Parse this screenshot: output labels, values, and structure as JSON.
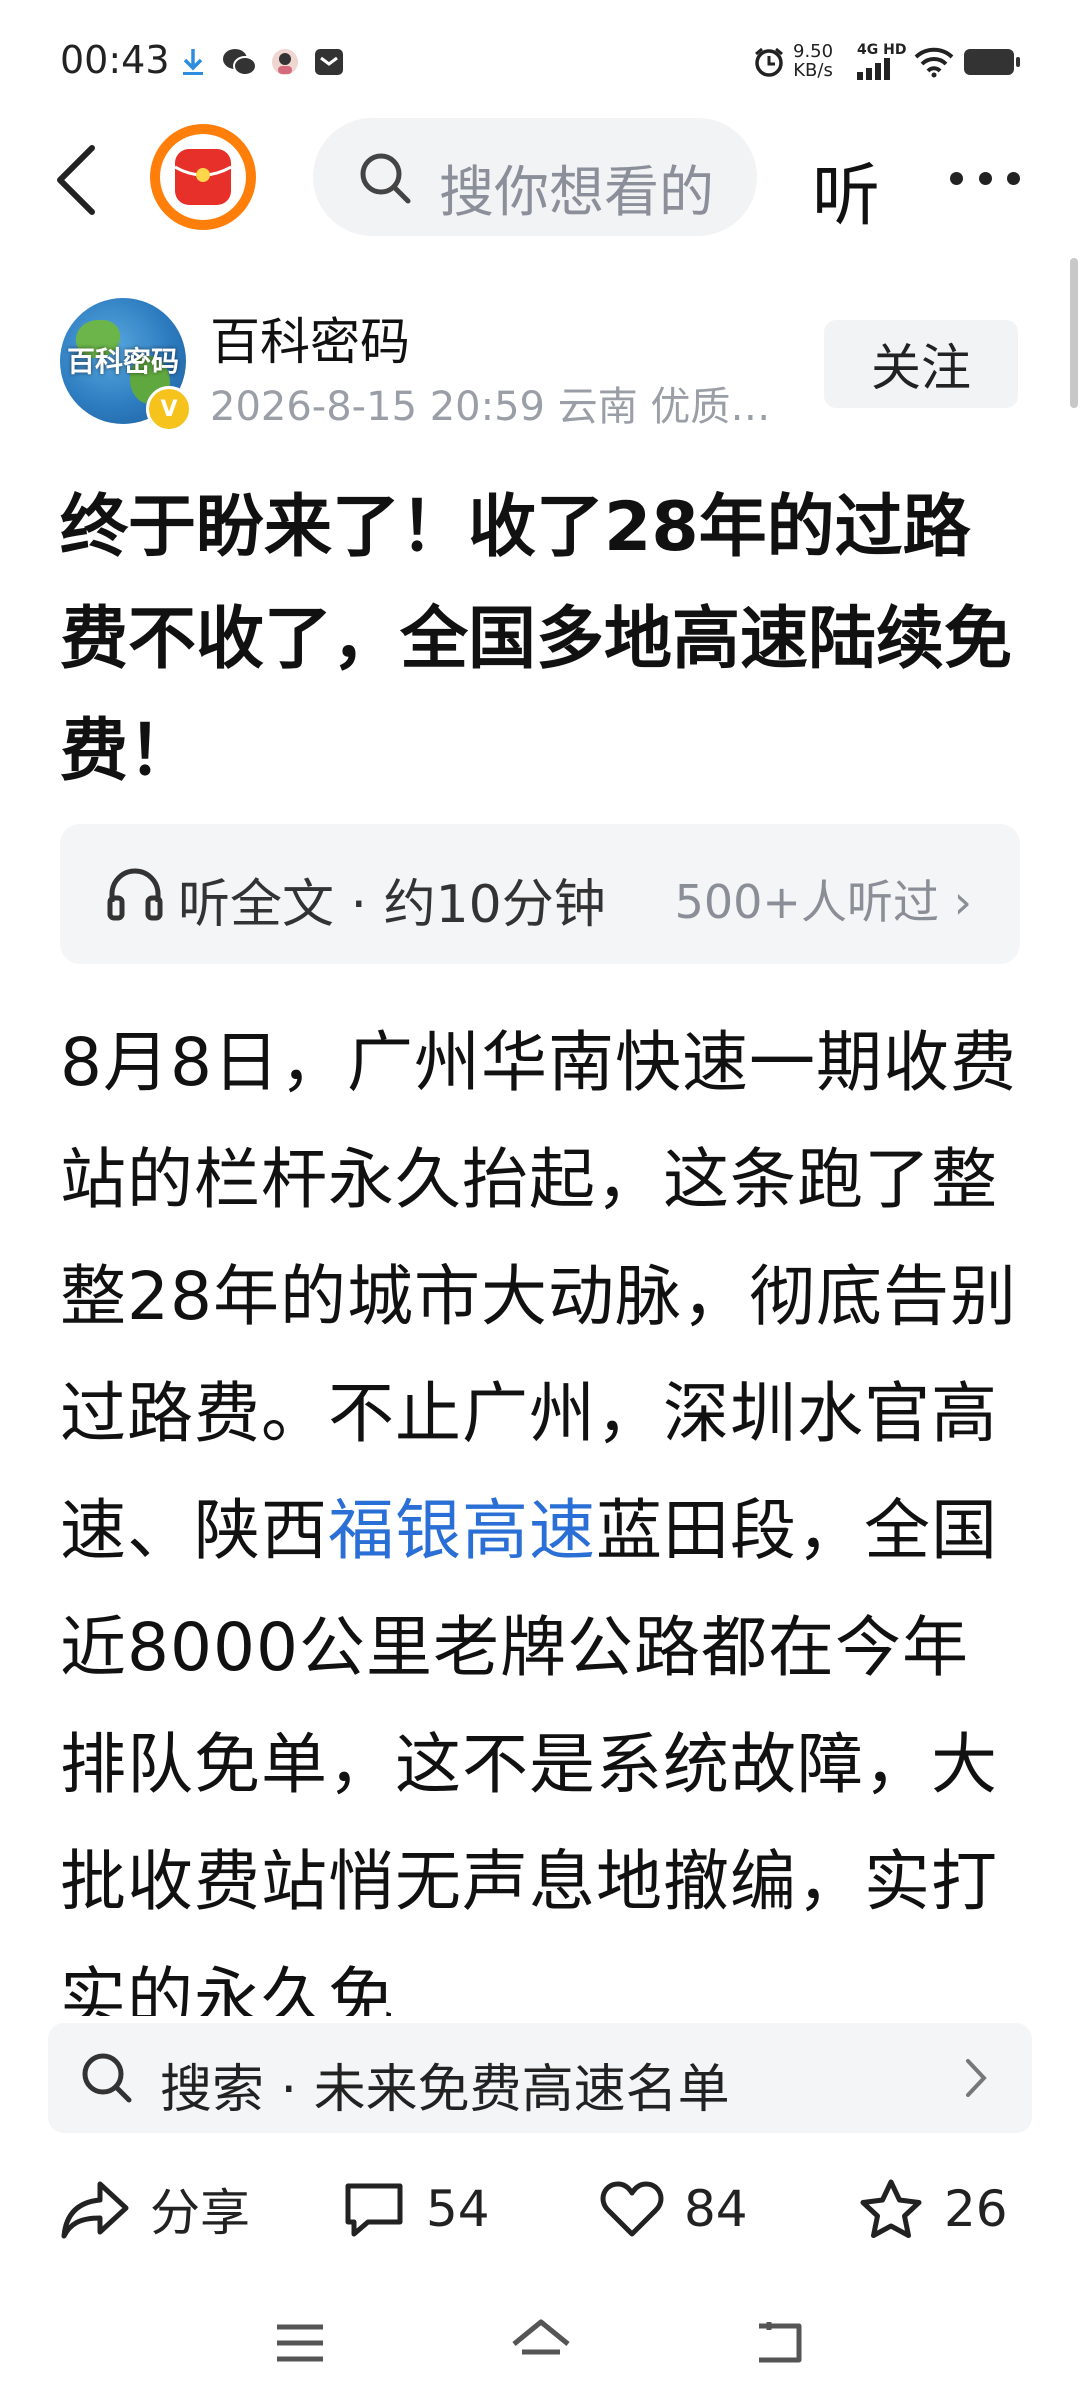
{
  "status_bar": {
    "time": "00:43",
    "net_speed_value": "9.50",
    "net_speed_unit": "KB/s",
    "network_type": "4G HD"
  },
  "header": {
    "search_placeholder": "搜你想看的",
    "listen_label": "听"
  },
  "author": {
    "avatar_text": "百科密码",
    "name": "百科密码",
    "meta": "2026-8-15 20:59 云南 优质…",
    "follow_label": "关注"
  },
  "article": {
    "title": "终于盼来了！收了28年的过路费不收了，全国多地高速陆续免费！",
    "listen_text": "听全文 · 约10分钟",
    "listen_count": "500+人听过",
    "body_part1": "8月8日，广州华南快速一期收费站的栏杆永久抬起，这条跑了整整28年的城市大动脉，彻底告别过路费。不止广州，深圳水官高速、陕西",
    "body_link": "福银高速",
    "body_part2": "蓝田段，全国近8000公里老牌公路都在今年排队免单，这不是系统故障，大批收费站悄无声息地撤编，实打实的永久免"
  },
  "search_suggestion": {
    "text": "搜索 · 未来免费高速名单"
  },
  "actions": {
    "share_label": "分享",
    "comment_count": "54",
    "like_count": "84",
    "favorite_count": "26"
  },
  "colors": {
    "link": "#2a6fd6",
    "accent_orange": "#ff7f0a",
    "verified_gold": "#f6c21c"
  }
}
